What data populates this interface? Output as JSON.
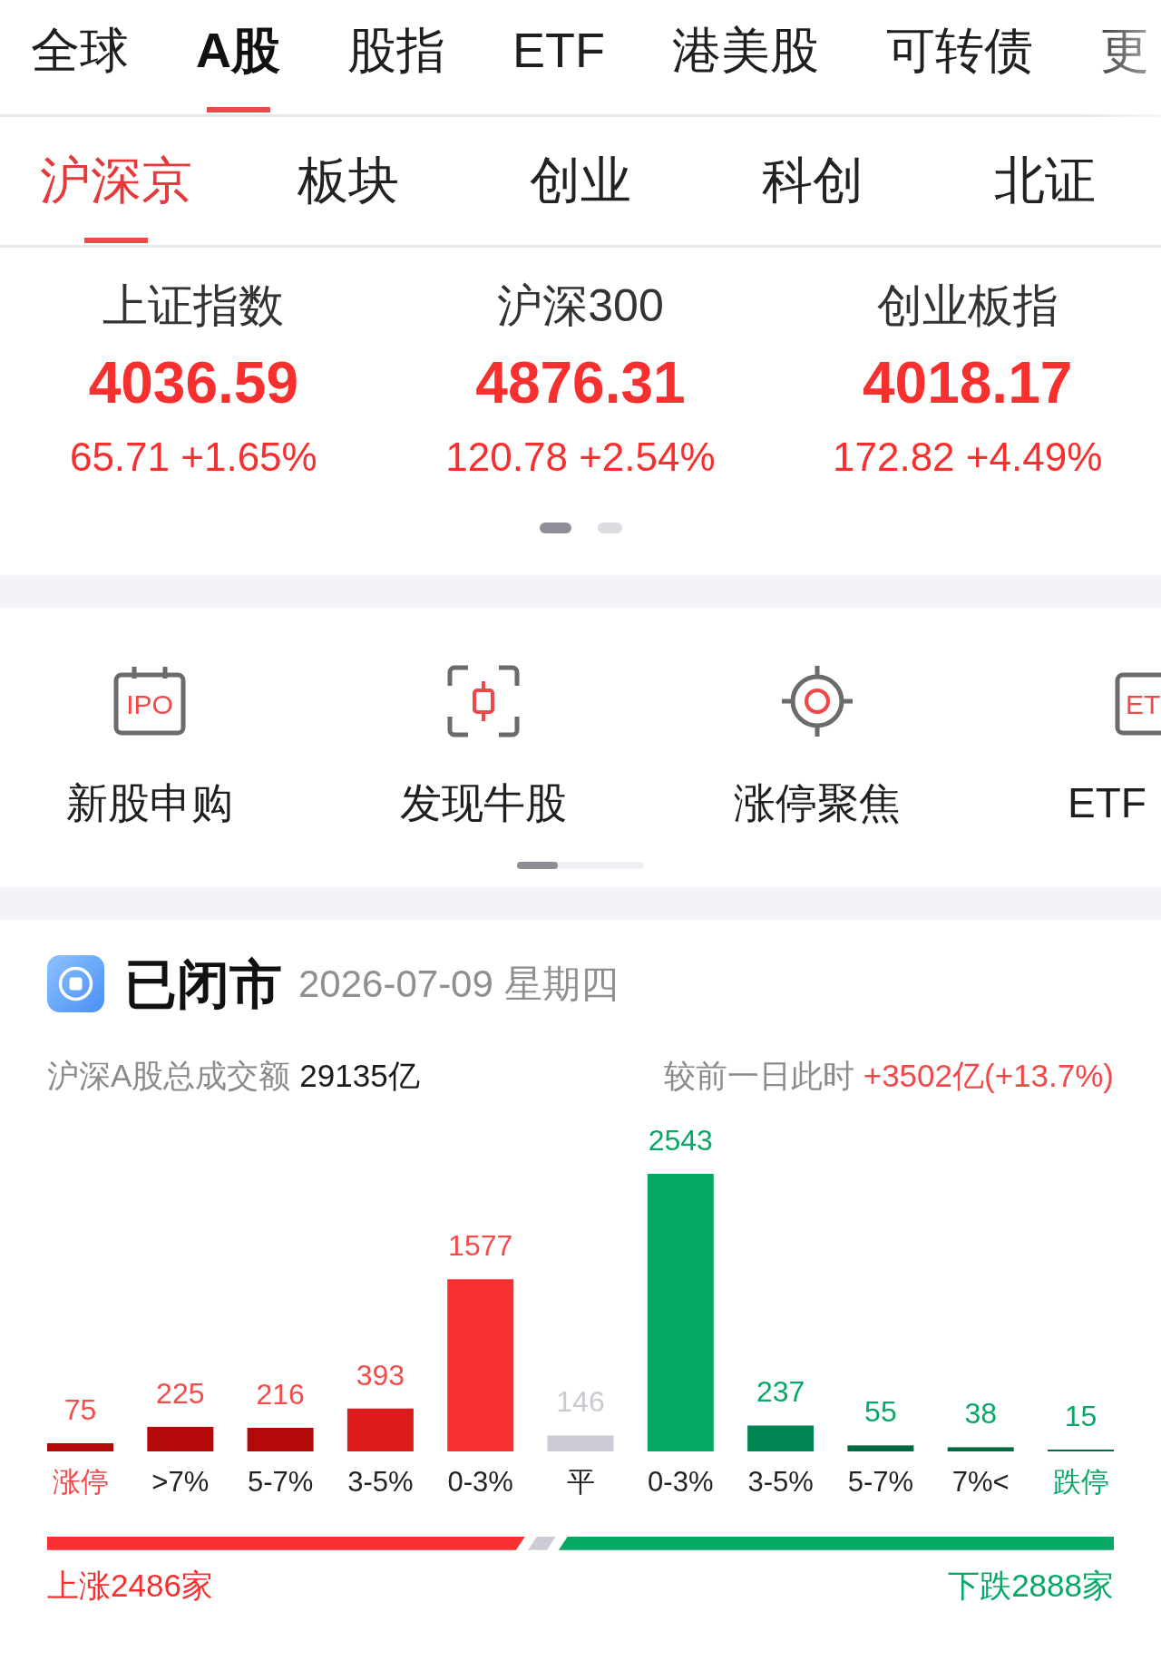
{
  "top_tabs": [
    {
      "label": "全球",
      "selected": false
    },
    {
      "label": "A股",
      "selected": true
    },
    {
      "label": "股指",
      "selected": false
    },
    {
      "label": "ETF",
      "selected": false
    },
    {
      "label": "港美股",
      "selected": false
    },
    {
      "label": "可转债",
      "selected": false
    },
    {
      "label": "更",
      "selected": false
    }
  ],
  "sub_tabs": [
    {
      "label": "沪深京",
      "selected": true
    },
    {
      "label": "板块",
      "selected": false
    },
    {
      "label": "创业",
      "selected": false
    },
    {
      "label": "科创",
      "selected": false
    },
    {
      "label": "北证",
      "selected": false
    }
  ],
  "indices": [
    {
      "name": "上证指数",
      "value": "4036.59",
      "change": "65.71 +1.65%"
    },
    {
      "name": "沪深300",
      "value": "4876.31",
      "change": "120.78 +2.54%"
    },
    {
      "name": "创业板指",
      "value": "4018.17",
      "change": "172.82 +4.49%"
    }
  ],
  "index_pager": [
    {
      "selected": true
    },
    {
      "selected": false
    }
  ],
  "shortcuts": [
    {
      "kind": "calendar",
      "icon_text": "IPO",
      "label": "新股申购"
    },
    {
      "kind": "scan",
      "label": "发现牛股"
    },
    {
      "kind": "target",
      "label": "涨停聚焦"
    },
    {
      "kind": "box",
      "icon_text": "ET",
      "label": "ETF"
    }
  ],
  "market_summary": {
    "status": "已闭市",
    "date": "2026-07-09 星期四",
    "turnover_label": "沪深A股总成交额",
    "turnover": "29135亿",
    "compare_label": "较前一日此时",
    "compare_change": "+3502亿(+13.7%)",
    "chart_data": {
      "type": "bar",
      "categories": [
        "涨停",
        ">7%",
        "5-7%",
        "3-5%",
        "0-3%",
        "平",
        "0-3%",
        "3-5%",
        "5-7%",
        "7%<",
        "跌停"
      ],
      "values": [
        75,
        225,
        216,
        393,
        1577,
        146,
        2543,
        237,
        55,
        38,
        15
      ],
      "data_labels": true
    },
    "rise_label": "上涨2486家",
    "fall_label": "下跌2888家"
  }
}
